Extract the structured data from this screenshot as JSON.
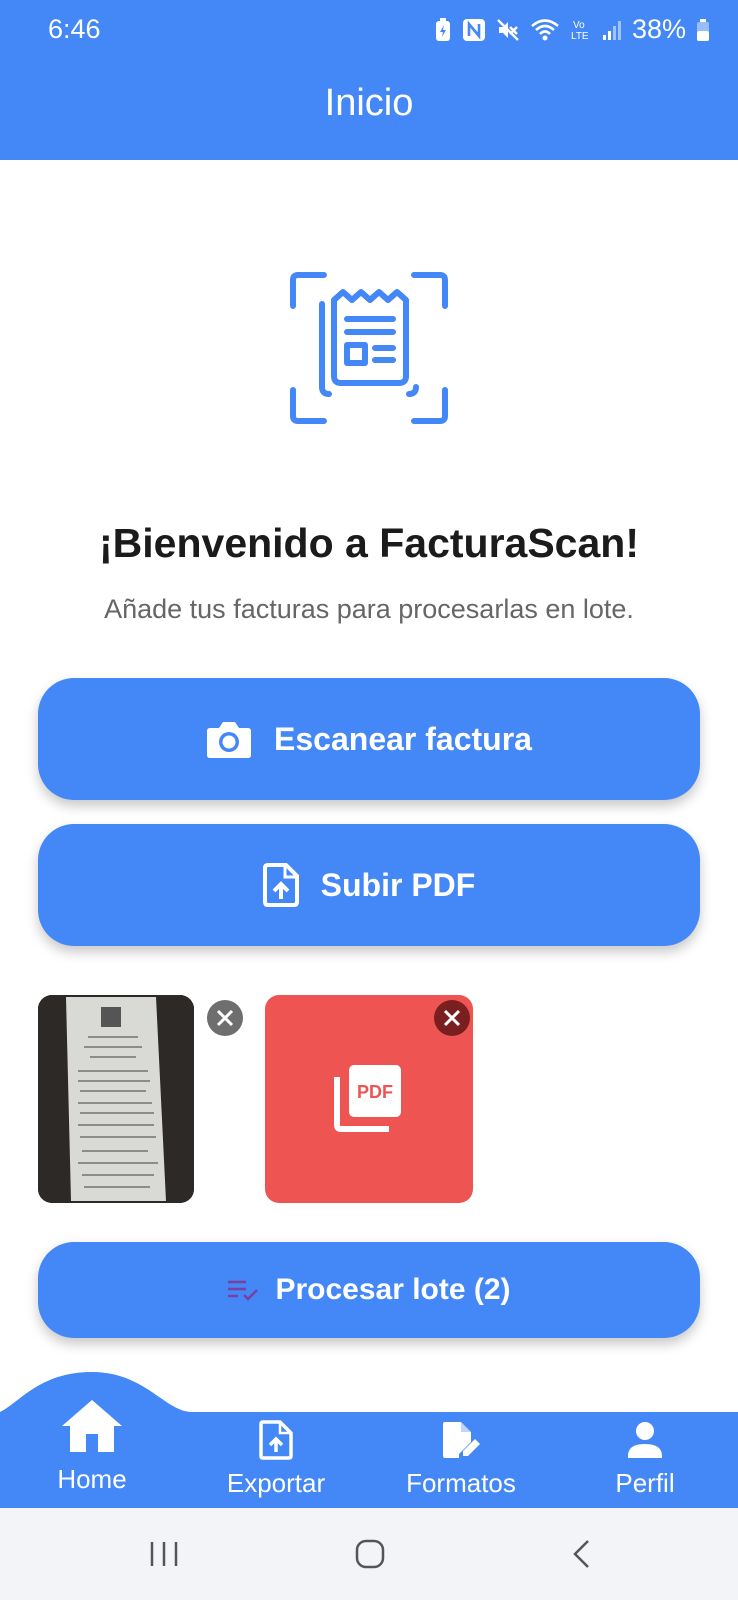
{
  "status_bar": {
    "time": "6:46",
    "battery": "38%",
    "icons": [
      "battery-saver-icon",
      "nfc-icon",
      "mute-icon",
      "wifi-icon",
      "volte-icon",
      "signal-icon",
      "battery-icon"
    ]
  },
  "app_bar": {
    "title": "Inicio"
  },
  "hero": {
    "icon": "receipt-scan-icon",
    "title": "¡Bienvenido a FacturaScan!",
    "subtitle": "Añade tus facturas para procesarlas en lote."
  },
  "actions": {
    "scan_label": "Escanear factura",
    "scan_icon": "camera-icon",
    "upload_label": "Subir PDF",
    "upload_icon": "file-upload-icon"
  },
  "batch": {
    "items": [
      {
        "type": "image",
        "icon": "receipt-photo"
      },
      {
        "type": "pdf",
        "icon": "pdf-icon"
      }
    ],
    "process_label": "Procesar lote (2)",
    "process_icon": "playlist-check-icon"
  },
  "bottom_nav": {
    "items": [
      {
        "label": "Home",
        "icon": "home-icon",
        "active": true
      },
      {
        "label": "Exportar",
        "icon": "file-upload-icon"
      },
      {
        "label": "Formatos",
        "icon": "edit-document-icon"
      },
      {
        "label": "Perfil",
        "icon": "person-icon"
      }
    ]
  },
  "colors": {
    "primary": "#4487f7",
    "pdf_red": "#ee5552",
    "title_text": "#1b1b1b",
    "subtitle_text": "#666666"
  }
}
